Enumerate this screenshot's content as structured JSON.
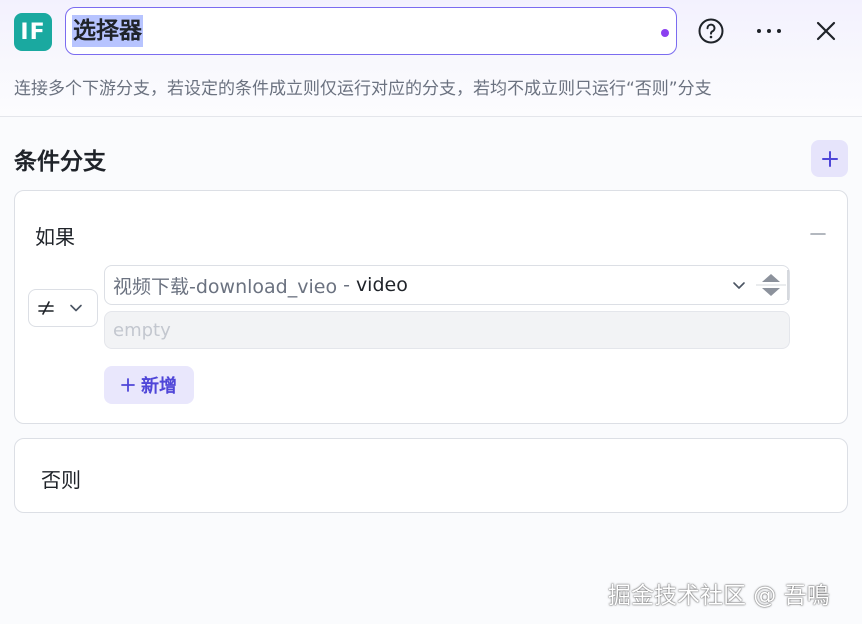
{
  "header": {
    "icon_text": "IF",
    "title_value": "选择器",
    "description": "连接多个下游分支，若设定的条件成立则仅运行对应的分支，若均不成立则只运行“否则”分支"
  },
  "section": {
    "title": "条件分支"
  },
  "if_branch": {
    "label": "如果",
    "condition": {
      "variable_source": "视频下载-download_vieo",
      "separator": "-",
      "variable_name": "video",
      "value_placeholder": "empty"
    },
    "add_label": "新增"
  },
  "else_branch": {
    "label": "否则"
  },
  "watermark": "掘金技术社区 @ 吾鳴",
  "colors": {
    "accent": "#4f46d8",
    "icon_bg": "#1aa9a0",
    "focus_border": "#7b6cf0"
  }
}
